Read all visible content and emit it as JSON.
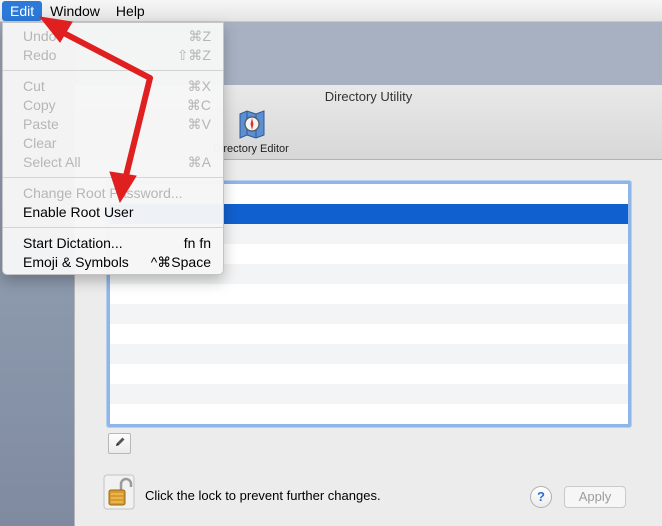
{
  "menubar": {
    "items": [
      {
        "label": "Edit"
      },
      {
        "label": "Window"
      },
      {
        "label": "Help"
      }
    ]
  },
  "edit_menu": {
    "groups": [
      [
        {
          "label": "Undo",
          "shortcut": "⌘Z",
          "enabled": false
        },
        {
          "label": "Redo",
          "shortcut": "⇧⌘Z",
          "enabled": false
        }
      ],
      [
        {
          "label": "Cut",
          "shortcut": "⌘X",
          "enabled": false
        },
        {
          "label": "Copy",
          "shortcut": "⌘C",
          "enabled": false
        },
        {
          "label": "Paste",
          "shortcut": "⌘V",
          "enabled": false
        },
        {
          "label": "Clear",
          "shortcut": "",
          "enabled": false
        },
        {
          "label": "Select All",
          "shortcut": "⌘A",
          "enabled": false
        }
      ],
      [
        {
          "label": "Change Root Password...",
          "shortcut": "",
          "enabled": false
        },
        {
          "label": "Enable Root User",
          "shortcut": "",
          "enabled": true
        }
      ],
      [
        {
          "label": "Start Dictation...",
          "shortcut": "fn fn",
          "enabled": true
        },
        {
          "label": "Emoji & Symbols",
          "shortcut": "^⌘Space",
          "enabled": true
        }
      ]
    ]
  },
  "window": {
    "title": "Directory Utility",
    "toolbar": {
      "directory_editor_label": "Directory Editor",
      "directory_editor_icon": "directory-editor-icon"
    },
    "list": {
      "selected_row_index": 1
    },
    "lock_text": "Click the lock to prevent further changes.",
    "help_label": "?",
    "apply_label": "Apply"
  },
  "annotation": {
    "arrow_color": "#e02020"
  }
}
